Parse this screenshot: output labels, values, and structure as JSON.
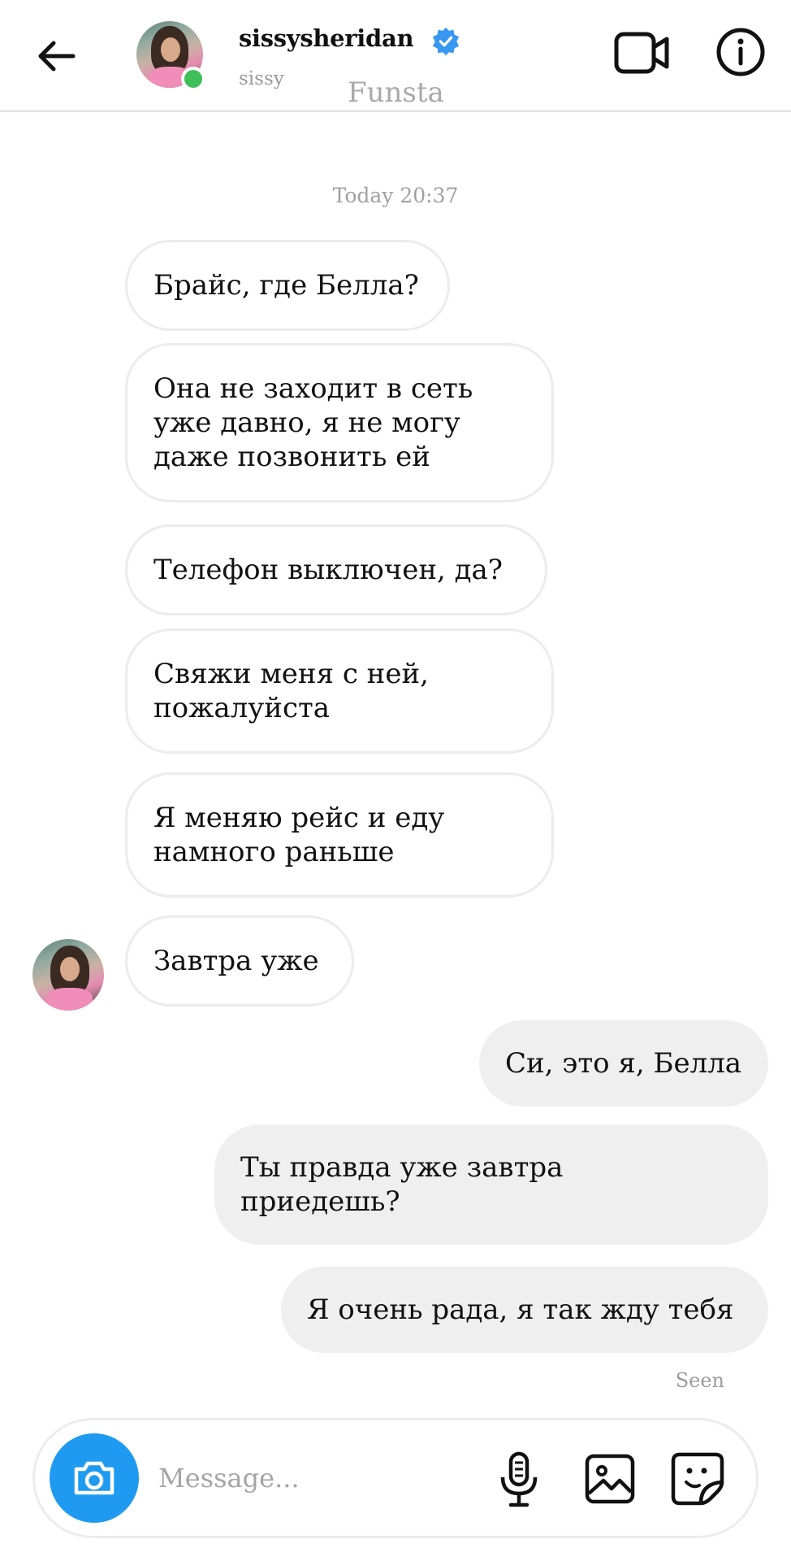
{
  "header": {
    "username": "sissysheridan",
    "subname": "sissy",
    "overlay_text": "Funsta",
    "icons": {
      "back": "arrow-left-icon",
      "verified": "verified-badge-icon",
      "video": "video-call-icon",
      "info": "info-icon"
    },
    "colors": {
      "verified": "#3897f0",
      "online": "#3ebf5a"
    }
  },
  "chat": {
    "timestamp": "Today 20:37",
    "incoming": [
      "Брайс, где Белла?",
      "Она не заходит в сеть\nуже давно, я не могу\nдаже позвонить ей",
      "Телефон выключен, да?",
      "Свяжи меня с ней,\nпожалуйста",
      "Я меняю рейс и еду\nнамного раньше",
      "Завтра уже"
    ],
    "outgoing": [
      "Си, это я, Белла",
      "Ты правда уже завтра\nприедешь?",
      "Я очень рада, я так жду тебя"
    ],
    "seen_label": "Seen"
  },
  "composer": {
    "placeholder": "Message...",
    "icons": {
      "camera": "camera-icon",
      "mic": "microphone-icon",
      "gallery": "gallery-icon",
      "sticker": "sticker-icon"
    },
    "colors": {
      "camera_bg": "#1e9bf0"
    }
  }
}
